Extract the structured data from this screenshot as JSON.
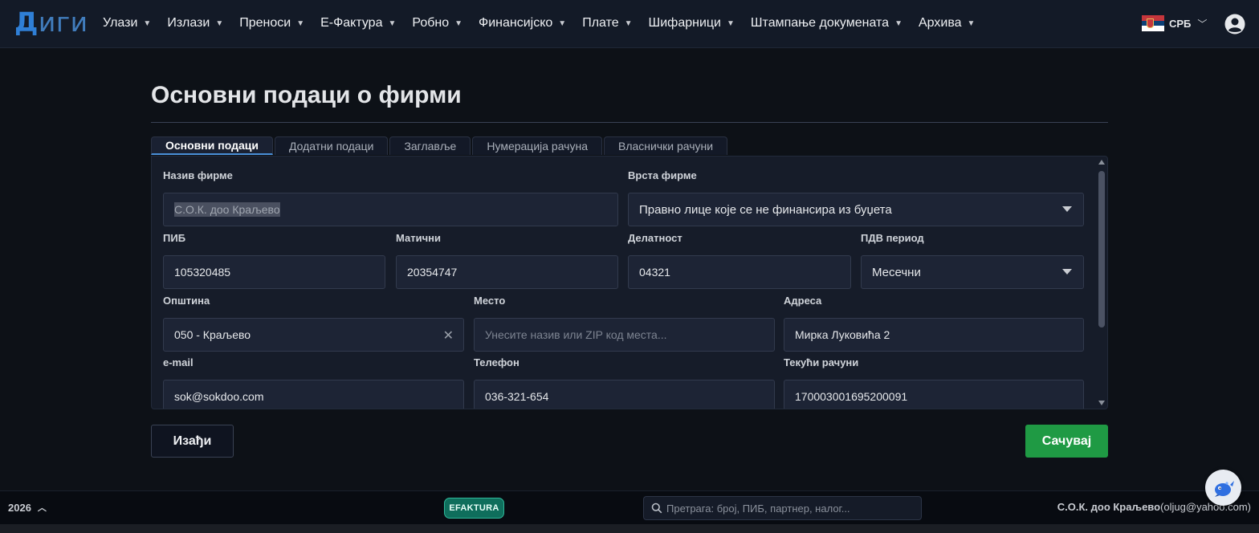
{
  "app": {
    "logo_first": "Д",
    "logo_rest": "иги"
  },
  "nav": {
    "items": [
      {
        "label": "Улази"
      },
      {
        "label": "Излази"
      },
      {
        "label": "Преноси"
      },
      {
        "label": "Е-Фактура"
      },
      {
        "label": "Робно"
      },
      {
        "label": "Финансијско"
      },
      {
        "label": "Плате"
      },
      {
        "label": "Шифарници"
      },
      {
        "label": "Штампање докумената"
      },
      {
        "label": "Архива"
      }
    ],
    "language": "СРБ"
  },
  "page": {
    "title": "Основни подаци о фирми"
  },
  "tabs": [
    {
      "label": "Основни подаци",
      "active": true
    },
    {
      "label": "Додатни подаци"
    },
    {
      "label": "Заглавље"
    },
    {
      "label": "Нумерација рачуна"
    },
    {
      "label": "Власнички рачуни"
    }
  ],
  "form": {
    "company_name": {
      "label": "Назив фирме",
      "value": "С.О.К. доо Краљево"
    },
    "company_type": {
      "label": "Врста фирме",
      "value": "Правно лице које се не финансира из буџета"
    },
    "pib": {
      "label": "ПИБ",
      "value": "105320485"
    },
    "registry": {
      "label": "Матични",
      "value": "20354747"
    },
    "activity": {
      "label": "Делатност",
      "value": "04321"
    },
    "vat_period": {
      "label": "ПДВ период",
      "value": "Месечни"
    },
    "municipality": {
      "label": "Општина",
      "value": "050 - Краљево"
    },
    "place": {
      "label": "Место",
      "value": "",
      "placeholder": "Унесите назив или ZIP код места..."
    },
    "address": {
      "label": "Адреса",
      "value": "Мирка Луковића 2"
    },
    "email": {
      "label": "e-mail",
      "value": "sok@sokdoo.com"
    },
    "phone": {
      "label": "Телефон",
      "value": "036-321-654"
    },
    "accounts": {
      "label": "Текући рачуни",
      "value": "170003001695200091"
    }
  },
  "actions": {
    "exit_label": "Изађи",
    "save_label": "Сачувај"
  },
  "footer": {
    "year": "2026",
    "efaktura_label": "EFAKTURA",
    "search_placeholder": "Претрага: број, ПИБ, партнер, налог...",
    "company_name": "С.О.К. доо Краљево",
    "company_email": "(oljug@yahoo.com)"
  },
  "colors": {
    "accent": "#4a8fd8",
    "save": "#1f9a44",
    "efaktura": "#0f6e5c"
  }
}
